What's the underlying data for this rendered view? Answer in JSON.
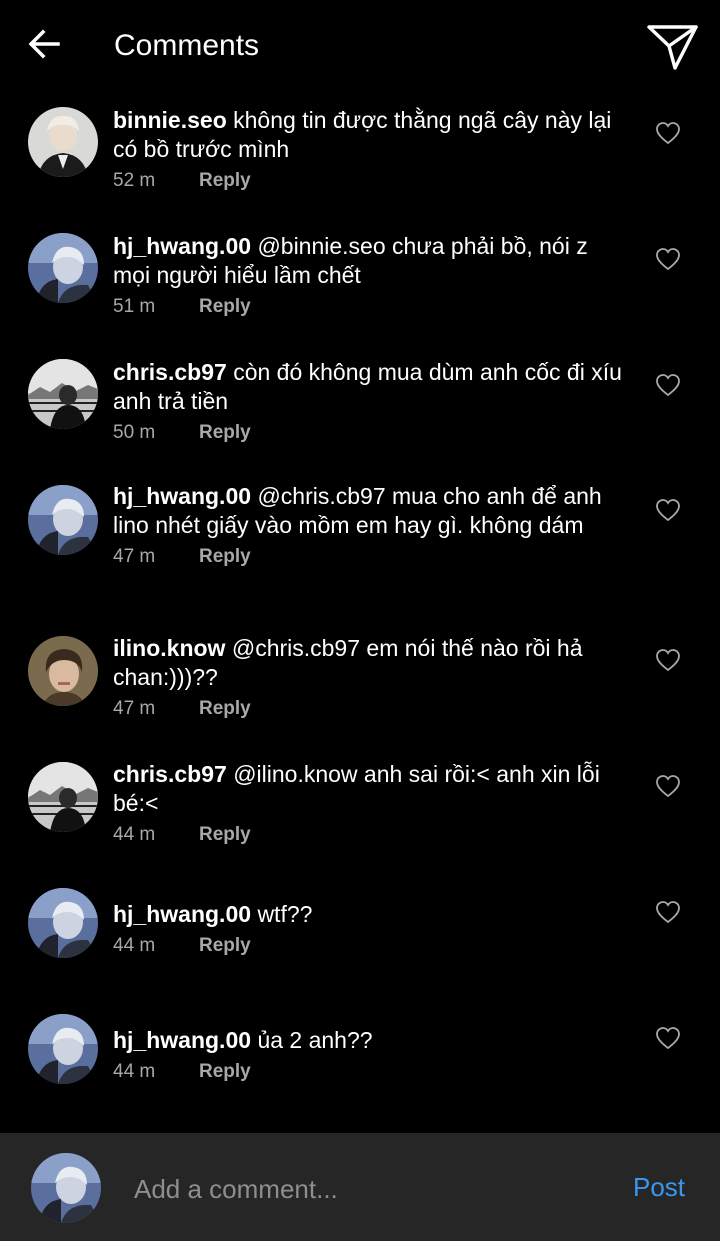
{
  "header": {
    "title": "Comments",
    "back_icon": "arrow-left-icon",
    "share_icon": "paper-plane-icon"
  },
  "comments": [
    {
      "username": "binnie.seo",
      "text": "không tin được thằng ngã cây này lại có bồ trước mình",
      "time": "52 m",
      "reply": "Reply",
      "avatar": "avatar-binnie-seo"
    },
    {
      "username": "hj_hwang.00",
      "text": "@binnie.seo chưa phải bồ, nói z mọi người hiểu lầm chết",
      "time": "51 m",
      "reply": "Reply",
      "avatar": "avatar-hj-hwang"
    },
    {
      "username": "chris.cb97",
      "text": "còn đó không mua dùm anh cốc đi xíu anh trả tiền",
      "time": "50 m",
      "reply": "Reply",
      "avatar": "avatar-chris-cb97"
    },
    {
      "username": "hj_hwang.00",
      "text": "@chris.cb97 mua cho anh để anh lino nhét giấy vào mồm em hay gì. không dám",
      "time": "47 m",
      "reply": "Reply",
      "avatar": "avatar-hj-hwang"
    },
    {
      "username": "ilino.know",
      "text": "@chris.cb97 em nói thế nào rồi hả chan:)))??",
      "time": "47 m",
      "reply": "Reply",
      "avatar": "avatar-ilino-know"
    },
    {
      "username": "chris.cb97",
      "text": "@ilino.know anh sai rồi:< anh xin lỗi bé:<",
      "time": "44 m",
      "reply": "Reply",
      "avatar": "avatar-chris-cb97"
    },
    {
      "username": "hj_hwang.00",
      "text": "wtf??",
      "time": "44 m",
      "reply": "Reply",
      "avatar": "avatar-hj-hwang"
    },
    {
      "username": "hj_hwang.00",
      "text": "ủa 2 anh??",
      "time": "44 m",
      "reply": "Reply",
      "avatar": "avatar-hj-hwang"
    }
  ],
  "footer": {
    "placeholder": "Add a comment...",
    "post_label": "Post"
  },
  "colors": {
    "background": "#000000",
    "footer_background": "#262626",
    "meta_text": "#a8a8a8",
    "post_blue": "#3897f0"
  }
}
